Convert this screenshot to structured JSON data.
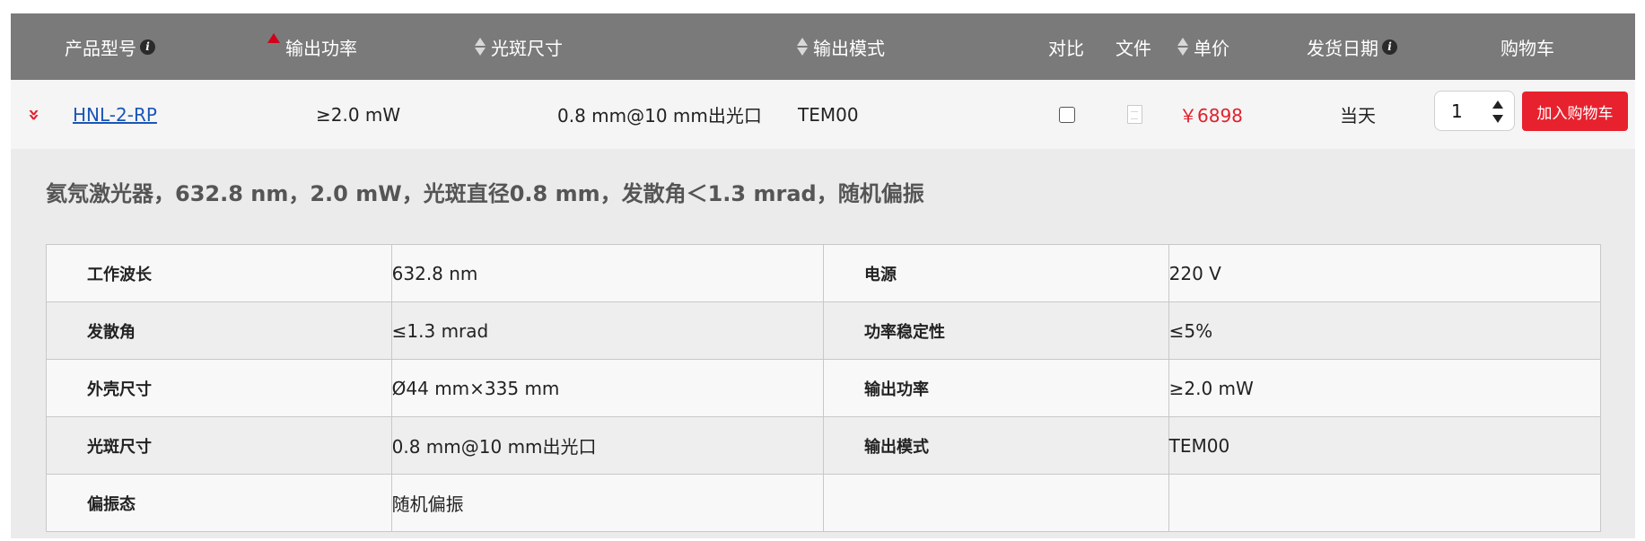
{
  "header": {
    "model": "产品型号",
    "power": "输出功率",
    "spot": "光斑尺寸",
    "mode": "输出模式",
    "compare": "对比",
    "file": "文件",
    "price": "单价",
    "ship": "发货日期",
    "cart": "购物车",
    "info_glyph": "i"
  },
  "product": {
    "expand_glyph": "»",
    "model": "HNL-2-RP",
    "power": "≥2.0 mW",
    "spot": "0.8 mm@10 mm出光口",
    "mode": "TEM00",
    "price": "￥6898",
    "ship": "当天",
    "quantity": "1",
    "add_to_cart": "加入购物车"
  },
  "details": {
    "description": "氦氖激光器，632.8 nm，2.0 mW，光斑直径0.8 mm，发散角＜1.3 mrad，随机偏振",
    "specs": [
      {
        "k1": "工作波长",
        "v1": "632.8 nm",
        "k2": "电源",
        "v2": "220 V"
      },
      {
        "k1": "发散角",
        "v1": "≤1.3 mrad",
        "k2": "功率稳定性",
        "v2": "≤5%"
      },
      {
        "k1": "外壳尺寸",
        "v1": "Ø44 mm×335 mm",
        "k2": "输出功率",
        "v2": "≥2.0 mW"
      },
      {
        "k1": "光斑尺寸",
        "v1": "0.8 mm@10 mm出光口",
        "k2": "输出模式",
        "v2": "TEM00"
      },
      {
        "k1": "偏振态",
        "v1": "随机偏振",
        "k2": "",
        "v2": ""
      }
    ]
  },
  "colors": {
    "header_bg": "#7a7a7a",
    "accent_red": "#e8212e",
    "link_blue": "#1a56b8"
  }
}
